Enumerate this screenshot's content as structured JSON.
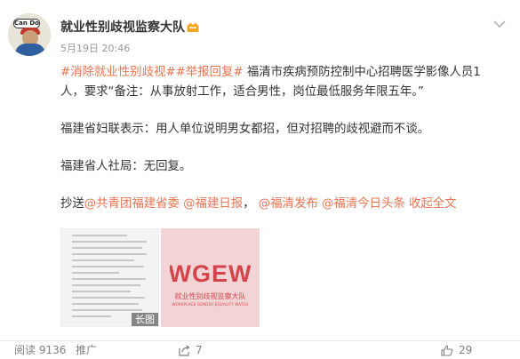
{
  "post": {
    "author": "就业性别歧视监察大队",
    "avatar_bubble": "Can Do",
    "timestamp": "5月19日 20:46",
    "paragraph1": {
      "tag1": "#消除就业性别歧视#",
      "tag2": "#举报回复#",
      "text_line1": " 福清市疾病预防控制中心招聘医学影像人员1",
      "text_line2": "人，要求“备注：从事放射工作，适合男性，岗位最低服务年限五年。”"
    },
    "paragraph2": "福建省妇联表示：用人单位说明男女都招，但对招聘的歧视避而不谈。",
    "paragraph3": "福建省人社局：无回复。",
    "cc": {
      "prefix": "抄送",
      "mention1": "@共青团福建省委",
      "mention2": "@福建日报",
      "sep": "，",
      "mention3": "@福清发布",
      "mention4": "@福清今日头条",
      "collapse": "收起全文"
    }
  },
  "images": {
    "long_badge": "长图",
    "logo_text": "WGEW",
    "logo_cn": "就业性别歧视监察大队",
    "logo_en": "WORKPLACE GENDER EQUALITY WATCH"
  },
  "actions": {
    "views": "阅读 9136",
    "promote": "推广",
    "shares": "7",
    "likes": "29"
  },
  "colors": {
    "accent": "#eb7350",
    "text": "#333333",
    "muted": "#999999",
    "logo_bg": "#f3d4d6",
    "logo_red": "#d6444b"
  },
  "icons": [
    "chevron-down-icon",
    "vip-badge-icon",
    "share-icon",
    "like-icon"
  ]
}
